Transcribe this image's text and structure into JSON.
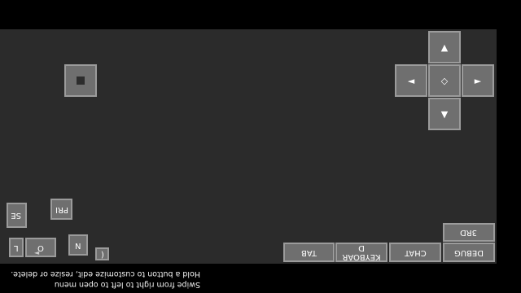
{
  "dpad": {
    "up": "▲",
    "left": "◄",
    "center": "◇",
    "right": "►",
    "down": "▼"
  },
  "bottom_bar": {
    "tab": "TAB",
    "keyboard": "KEYBOARD",
    "chat": "CHAT",
    "debug": "DEBUG",
    "third_person": "3RD"
  },
  "left_cluster": {
    "priv": "PRI",
    "s_e": "SE",
    "n": "N",
    "l": "L",
    "bracket": "(",
    "o": "O",
    "arrow": "◄"
  },
  "info_text": {
    "line1": "Swipe from right to left to open menu",
    "line2": "Hold a button to customize edit, resize or delete."
  }
}
